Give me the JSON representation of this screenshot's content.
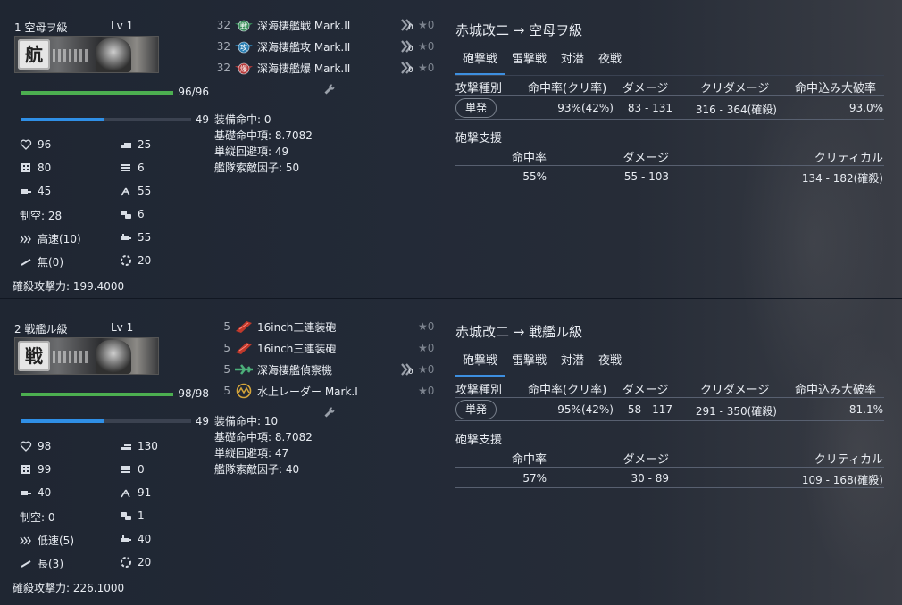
{
  "attacker": "赤城改二",
  "arrow": "→",
  "ships": [
    {
      "title": "1 空母ヲ級",
      "lv": "Lv 1",
      "badge": "航",
      "hp_text": "96/96",
      "hp_fraction": 1.0,
      "morale_text": "49",
      "morale_fraction": 0.49,
      "stats": {
        "hp": "96",
        "armor": "80",
        "evasion": "45",
        "air": "制空: 28",
        "speed": "高速(10)",
        "range": "無(0)",
        "firepower": "25",
        "torpedo": "6",
        "aa": "55",
        "asw": "6",
        "los": "55",
        "luck": "20"
      },
      "kill_power": "確殺攻撃力: 199.4000",
      "equipment": [
        {
          "slots": "32",
          "name": "深海棲艦戦 Mark.II",
          "icon": "fighter-icon",
          "icon_color": "#3a8f5a",
          "icon_char": "戦",
          "prof": true,
          "star": "★0"
        },
        {
          "slots": "32",
          "name": "深海棲艦攻 Mark.II",
          "icon": "torpedo-bomber-icon",
          "icon_color": "#2b7fb3",
          "icon_char": "攻",
          "prof": true,
          "star": "★0"
        },
        {
          "slots": "32",
          "name": "深海棲艦爆 Mark.II",
          "icon": "dive-bomber-icon",
          "icon_color": "#b73a3a",
          "icon_char": "爆",
          "prof": true,
          "star": "★0"
        }
      ],
      "eq_stats": [
        "装備命中: 0",
        "基礎命中項: 8.7082",
        "単縦回避項: 49",
        "艦隊索敵因子: 50"
      ],
      "target": "空母ヲ級",
      "tabs": [
        "砲撃戦",
        "雷撃戦",
        "対潜",
        "夜戦"
      ],
      "active_tab": 0,
      "headers": [
        "攻撃種別",
        "命中率(クリ率)",
        "ダメージ",
        "クリダメージ",
        "命中込み大破率"
      ],
      "row": {
        "type": "単発",
        "hit": "93%(42%)",
        "damage": "83 - 131",
        "crit": "316 - 364(確殺)",
        "rate": "93.0%"
      },
      "support_label": "砲撃支援",
      "support_headers": [
        "命中率",
        "ダメージ",
        "クリティカル"
      ],
      "support_row": {
        "hit": "55%",
        "damage": "55 - 103",
        "crit": "134 - 182(確殺)"
      }
    },
    {
      "title": "2 戦艦ル級",
      "lv": "Lv 1",
      "badge": "戦",
      "hp_text": "98/98",
      "hp_fraction": 1.0,
      "morale_text": "49",
      "morale_fraction": 0.49,
      "stats": {
        "hp": "98",
        "armor": "99",
        "evasion": "40",
        "air": "制空: 0",
        "speed": "低速(5)",
        "range": "長(3)",
        "firepower": "130",
        "torpedo": "0",
        "aa": "91",
        "asw": "1",
        "los": "40",
        "luck": "20"
      },
      "kill_power": "確殺攻撃力: 226.1000",
      "equipment": [
        {
          "slots": "5",
          "name": "16inch三連装砲",
          "icon": "main-gun-icon",
          "icon_color": "#c0392b",
          "icon_char": "",
          "prof": false,
          "star": "★0"
        },
        {
          "slots": "5",
          "name": "16inch三連装砲",
          "icon": "main-gun-icon",
          "icon_color": "#c0392b",
          "icon_char": "",
          "prof": false,
          "star": "★0"
        },
        {
          "slots": "5",
          "name": "深海棲艦偵察機",
          "icon": "recon-plane-icon",
          "icon_color": "#4caf7a",
          "icon_char": "",
          "prof": true,
          "star": "★0"
        },
        {
          "slots": "5",
          "name": "水上レーダー Mark.I",
          "icon": "radar-icon",
          "icon_color": "#d4a43a",
          "icon_char": "",
          "prof": false,
          "star": "★0"
        }
      ],
      "eq_stats": [
        "装備命中: 10",
        "基礎命中項: 8.7082",
        "単縦回避項: 47",
        "艦隊索敵因子: 40"
      ],
      "target": "戦艦ル級",
      "tabs": [
        "砲撃戦",
        "雷撃戦",
        "対潜",
        "夜戦"
      ],
      "active_tab": 0,
      "headers": [
        "攻撃種別",
        "命中率(クリ率)",
        "ダメージ",
        "クリダメージ",
        "命中込み大破率"
      ],
      "row": {
        "type": "単発",
        "hit": "95%(42%)",
        "damage": "58 - 117",
        "crit": "291 - 350(確殺)",
        "rate": "81.1%"
      },
      "support_label": "砲撃支援",
      "support_headers": [
        "命中率",
        "ダメージ",
        "クリティカル"
      ],
      "support_row": {
        "hit": "57%",
        "damage": "30 - 89",
        "crit": "109 - 168(確殺)"
      }
    }
  ],
  "colors": {
    "hp": "#4caf50",
    "morale": "#2f8fe6",
    "tab_active": "#3d8fe0"
  }
}
